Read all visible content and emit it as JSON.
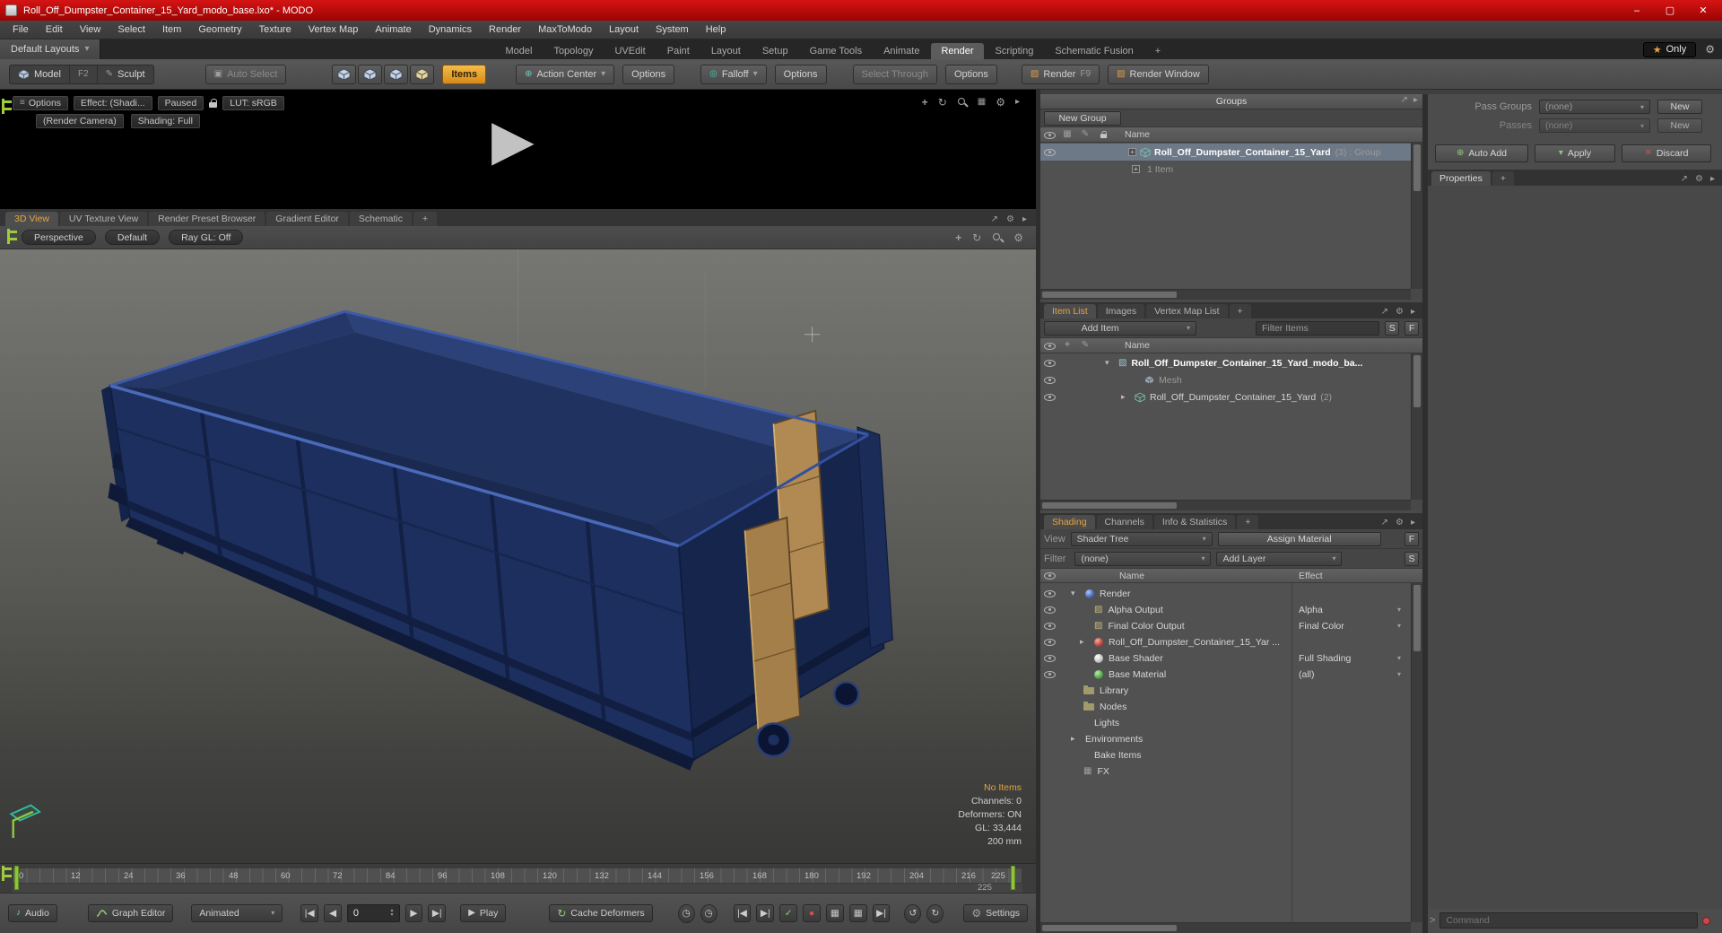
{
  "colors": {
    "titlebar_red": "#c01010",
    "accent_orange": "#e8a33d",
    "dumpster_blue": "#1d2f5e",
    "wood_tan": "#b08a52",
    "marker_green": "#9ccb3b"
  },
  "icons": {
    "play": "▶",
    "gear": "⚙",
    "star": "★",
    "note": "♪",
    "check": "✓",
    "record": "●",
    "chev_down": "▾",
    "chev_right": "▸",
    "plus": "+",
    "close": "✕",
    "maximize": "▢",
    "minimize": "–",
    "menu": "≡",
    "target": "⊕",
    "falloff": "◎",
    "photo": "▨",
    "pencil": "✎",
    "grid": "▦",
    "clock": "◷",
    "loop": "↻",
    "undo": "↺",
    "step_back": "|◀",
    "frame_back": "◀",
    "frame_fwd": "▶",
    "step_fwd": "▶|",
    "expand": "↗",
    "pan": "+",
    "rotate": "↻",
    "square": "▣",
    "tri_up": "▴"
  },
  "window": {
    "title": "Roll_Off_Dumpster_Container_15_Yard_modo_base.lxo* - MODO"
  },
  "menu": {
    "items": [
      "File",
      "Edit",
      "View",
      "Select",
      "Item",
      "Geometry",
      "Texture",
      "Vertex Map",
      "Animate",
      "Dynamics",
      "Render",
      "MaxToModo",
      "Layout",
      "System",
      "Help"
    ]
  },
  "layout_bar": {
    "default_layouts": "Default Layouts",
    "tabs": [
      "Model",
      "Topology",
      "UVEdit",
      "Paint",
      "Layout",
      "Setup",
      "Game Tools",
      "Animate",
      "Render",
      "Scripting",
      "Schematic Fusion"
    ],
    "add_tab": "+",
    "only": "Only"
  },
  "toolbar": {
    "model": "Model",
    "model_key": "F2",
    "sculpt": "Sculpt",
    "auto_select": "Auto Select",
    "items_mode": "Items",
    "action_center": "Action Center",
    "options_label": "Options",
    "falloff": "Falloff",
    "select_through": "Select Through",
    "render": "Render",
    "render_key": "F9",
    "render_window": "Render Window"
  },
  "render_preview": {
    "options": "Options",
    "effect": "Effect: (Shadi...",
    "paused": "Paused",
    "lut": "LUT: sRGB",
    "camera": "(Render Camera)",
    "shading": "Shading: Full"
  },
  "viewport": {
    "tabs": [
      "3D View",
      "UV Texture View",
      "Render Preset Browser",
      "Gradient Editor",
      "Schematic"
    ],
    "add_tab": "+",
    "perspective": "Perspective",
    "default_preset": "Default",
    "raygl": "Ray GL: Off",
    "info": {
      "no_items": "No Items",
      "channels": "Channels: 0",
      "deformers": "Deformers: ON",
      "gl": "GL: 33,444",
      "scale": "200 mm"
    }
  },
  "timeline": {
    "ticks": [
      "0",
      "12",
      "24",
      "36",
      "48",
      "60",
      "72",
      "84",
      "96",
      "108",
      "120",
      "132",
      "144",
      "156",
      "168",
      "180",
      "192",
      "204",
      "216"
    ],
    "end_frame": "225"
  },
  "transport": {
    "audio": "Audio",
    "graph_editor": "Graph Editor",
    "anim_mode": "Animated",
    "frame": "0",
    "play": "Play",
    "cache_deformers": "Cache Deformers",
    "settings": "Settings"
  },
  "groups": {
    "title": "Groups",
    "new_group": "New Group",
    "name_header": "Name",
    "row_name": "Roll_Off_Dumpster_Container_15_Yard",
    "row_suffix": "(3) : Group",
    "row_sub": "1 Item"
  },
  "item_list": {
    "tabs": [
      "Item List",
      "Images",
      "Vertex Map List"
    ],
    "add_tab": "+",
    "add_item": "Add Item",
    "filter": "Filter Items",
    "s": "S",
    "f": "F",
    "name_header": "Name",
    "rows": [
      {
        "name": "Roll_Off_Dumpster_Container_15_Yard_modo_ba..."
      },
      {
        "name": "Mesh"
      },
      {
        "name": "Roll_Off_Dumpster_Container_15_Yard",
        "suffix": "(2)"
      }
    ]
  },
  "shading": {
    "tabs": [
      "Shading",
      "Channels",
      "Info & Statistics"
    ],
    "add_tab": "+",
    "view_label": "View",
    "view_value": "Shader Tree",
    "assign_material": "Assign Material",
    "f": "F",
    "filter_label": "Filter",
    "filter_value": "(none)",
    "add_layer": "Add Layer",
    "s": "S",
    "name_header": "Name",
    "effect_header": "Effect",
    "rows": [
      {
        "name": "Render",
        "effect": ""
      },
      {
        "name": "Alpha Output",
        "effect": "Alpha"
      },
      {
        "name": "Final Color Output",
        "effect": "Final Color"
      },
      {
        "name": "Roll_Off_Dumpster_Container_15_Yar ...",
        "effect": ""
      },
      {
        "name": "Base Shader",
        "effect": "Full Shading"
      },
      {
        "name": "Base Material",
        "effect": "(all)"
      },
      {
        "name": "Library",
        "effect": ""
      },
      {
        "name": "Nodes",
        "effect": ""
      },
      {
        "name": "Lights",
        "effect": ""
      },
      {
        "name": "Environments",
        "effect": ""
      },
      {
        "name": "Bake Items",
        "effect": ""
      },
      {
        "name": "FX",
        "effect": ""
      }
    ]
  },
  "passes_panel": {
    "pass_groups": "Pass Groups",
    "pass_groups_value": "(none)",
    "new_label": "New",
    "passes": "Passes",
    "passes_value": "(none)",
    "auto_add": "Auto Add",
    "apply": "Apply",
    "discard": "Discard",
    "properties_tab": "Properties",
    "add_tab": "+"
  },
  "command": {
    "prompt": ">",
    "placeholder": "Command"
  }
}
